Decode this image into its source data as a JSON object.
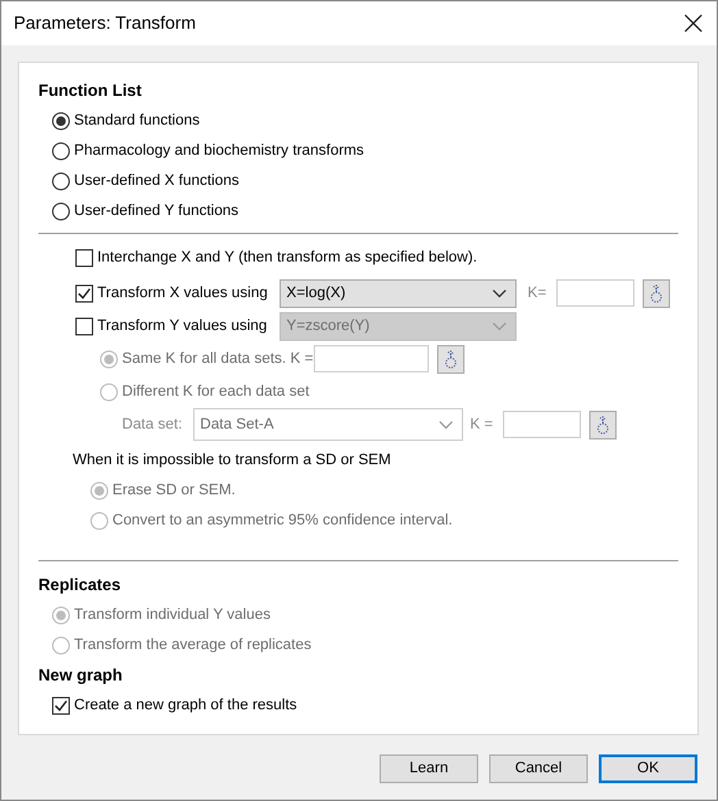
{
  "window": {
    "title": "Parameters: Transform"
  },
  "function_list": {
    "heading": "Function List",
    "options": [
      {
        "label": "Standard functions",
        "selected": true
      },
      {
        "label": "Pharmacology and biochemistry transforms",
        "selected": false
      },
      {
        "label": "User-defined X functions",
        "selected": false
      },
      {
        "label": "User-defined Y functions",
        "selected": false
      }
    ]
  },
  "transform": {
    "interchange": {
      "label": "Interchange X and Y (then transform as specified below).",
      "checked": false
    },
    "transform_x": {
      "label": "Transform X values using",
      "checked": true,
      "function": "X=log(X)",
      "disabled": false,
      "k": {
        "label": "K=",
        "disabled": true
      }
    },
    "transform_y": {
      "label": "Transform Y values using",
      "checked": false,
      "function": "Y=zscore(Y)",
      "disabled": true
    },
    "k_options": [
      {
        "label": "Same K for all data sets. K =",
        "selected": true,
        "disabled": true,
        "has_field": true
      },
      {
        "label": "Different K for each data set",
        "selected": false,
        "disabled": true,
        "has_field": false
      }
    ],
    "data_set": {
      "label": "Data set:",
      "value": "Data Set-A",
      "k_label": "K =",
      "disabled": true
    },
    "sd_heading": "When it is impossible to transform a SD or SEM",
    "sd_options": [
      {
        "label": "Erase SD or SEM.",
        "selected": true,
        "disabled": true
      },
      {
        "label": "Convert to an asymmetric 95% confidence interval.",
        "selected": false,
        "disabled": true
      }
    ]
  },
  "replicates": {
    "heading": "Replicates",
    "options": [
      {
        "label": "Transform individual Y values",
        "selected": true,
        "disabled": true
      },
      {
        "label": "Transform the average of replicates",
        "selected": false,
        "disabled": true
      }
    ]
  },
  "new_graph": {
    "heading": "New graph",
    "create": {
      "label": "Create a new graph of the results",
      "checked": true
    }
  },
  "buttons": [
    {
      "label": "Learn",
      "default": false
    },
    {
      "label": "Cancel",
      "default": false
    },
    {
      "label": "OK",
      "default": true
    }
  ]
}
